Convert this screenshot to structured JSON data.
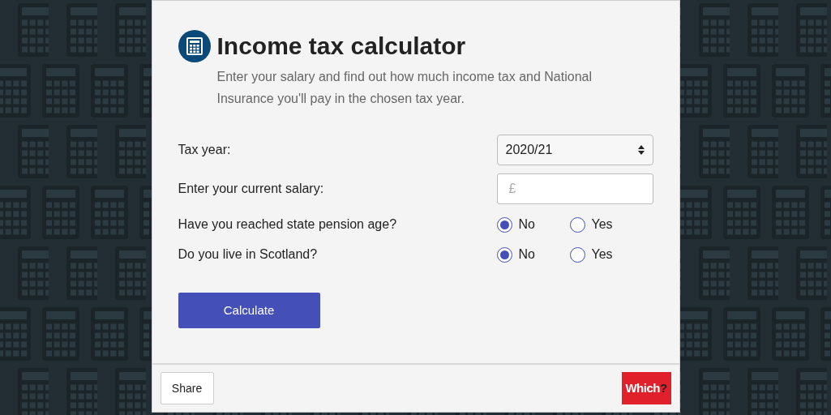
{
  "header": {
    "title": "Income tax calculator",
    "description": "Enter your salary and find out how much income tax and National Insurance you'll pay in the chosen tax year."
  },
  "form": {
    "tax_year": {
      "label": "Tax year:",
      "value": "2020/21"
    },
    "salary": {
      "label": "Enter your current salary:",
      "placeholder": "£"
    },
    "questions": [
      {
        "label": "Have you reached state pension age?",
        "options": [
          {
            "label": "No",
            "selected": true
          },
          {
            "label": "Yes",
            "selected": false
          }
        ]
      },
      {
        "label": "Do you live in Scotland?",
        "options": [
          {
            "label": "No",
            "selected": true
          },
          {
            "label": "Yes",
            "selected": false
          }
        ]
      }
    ],
    "submit": "Calculate"
  },
  "footer": {
    "share": "Share",
    "logo": {
      "text": "Which",
      "mark": "?"
    }
  }
}
